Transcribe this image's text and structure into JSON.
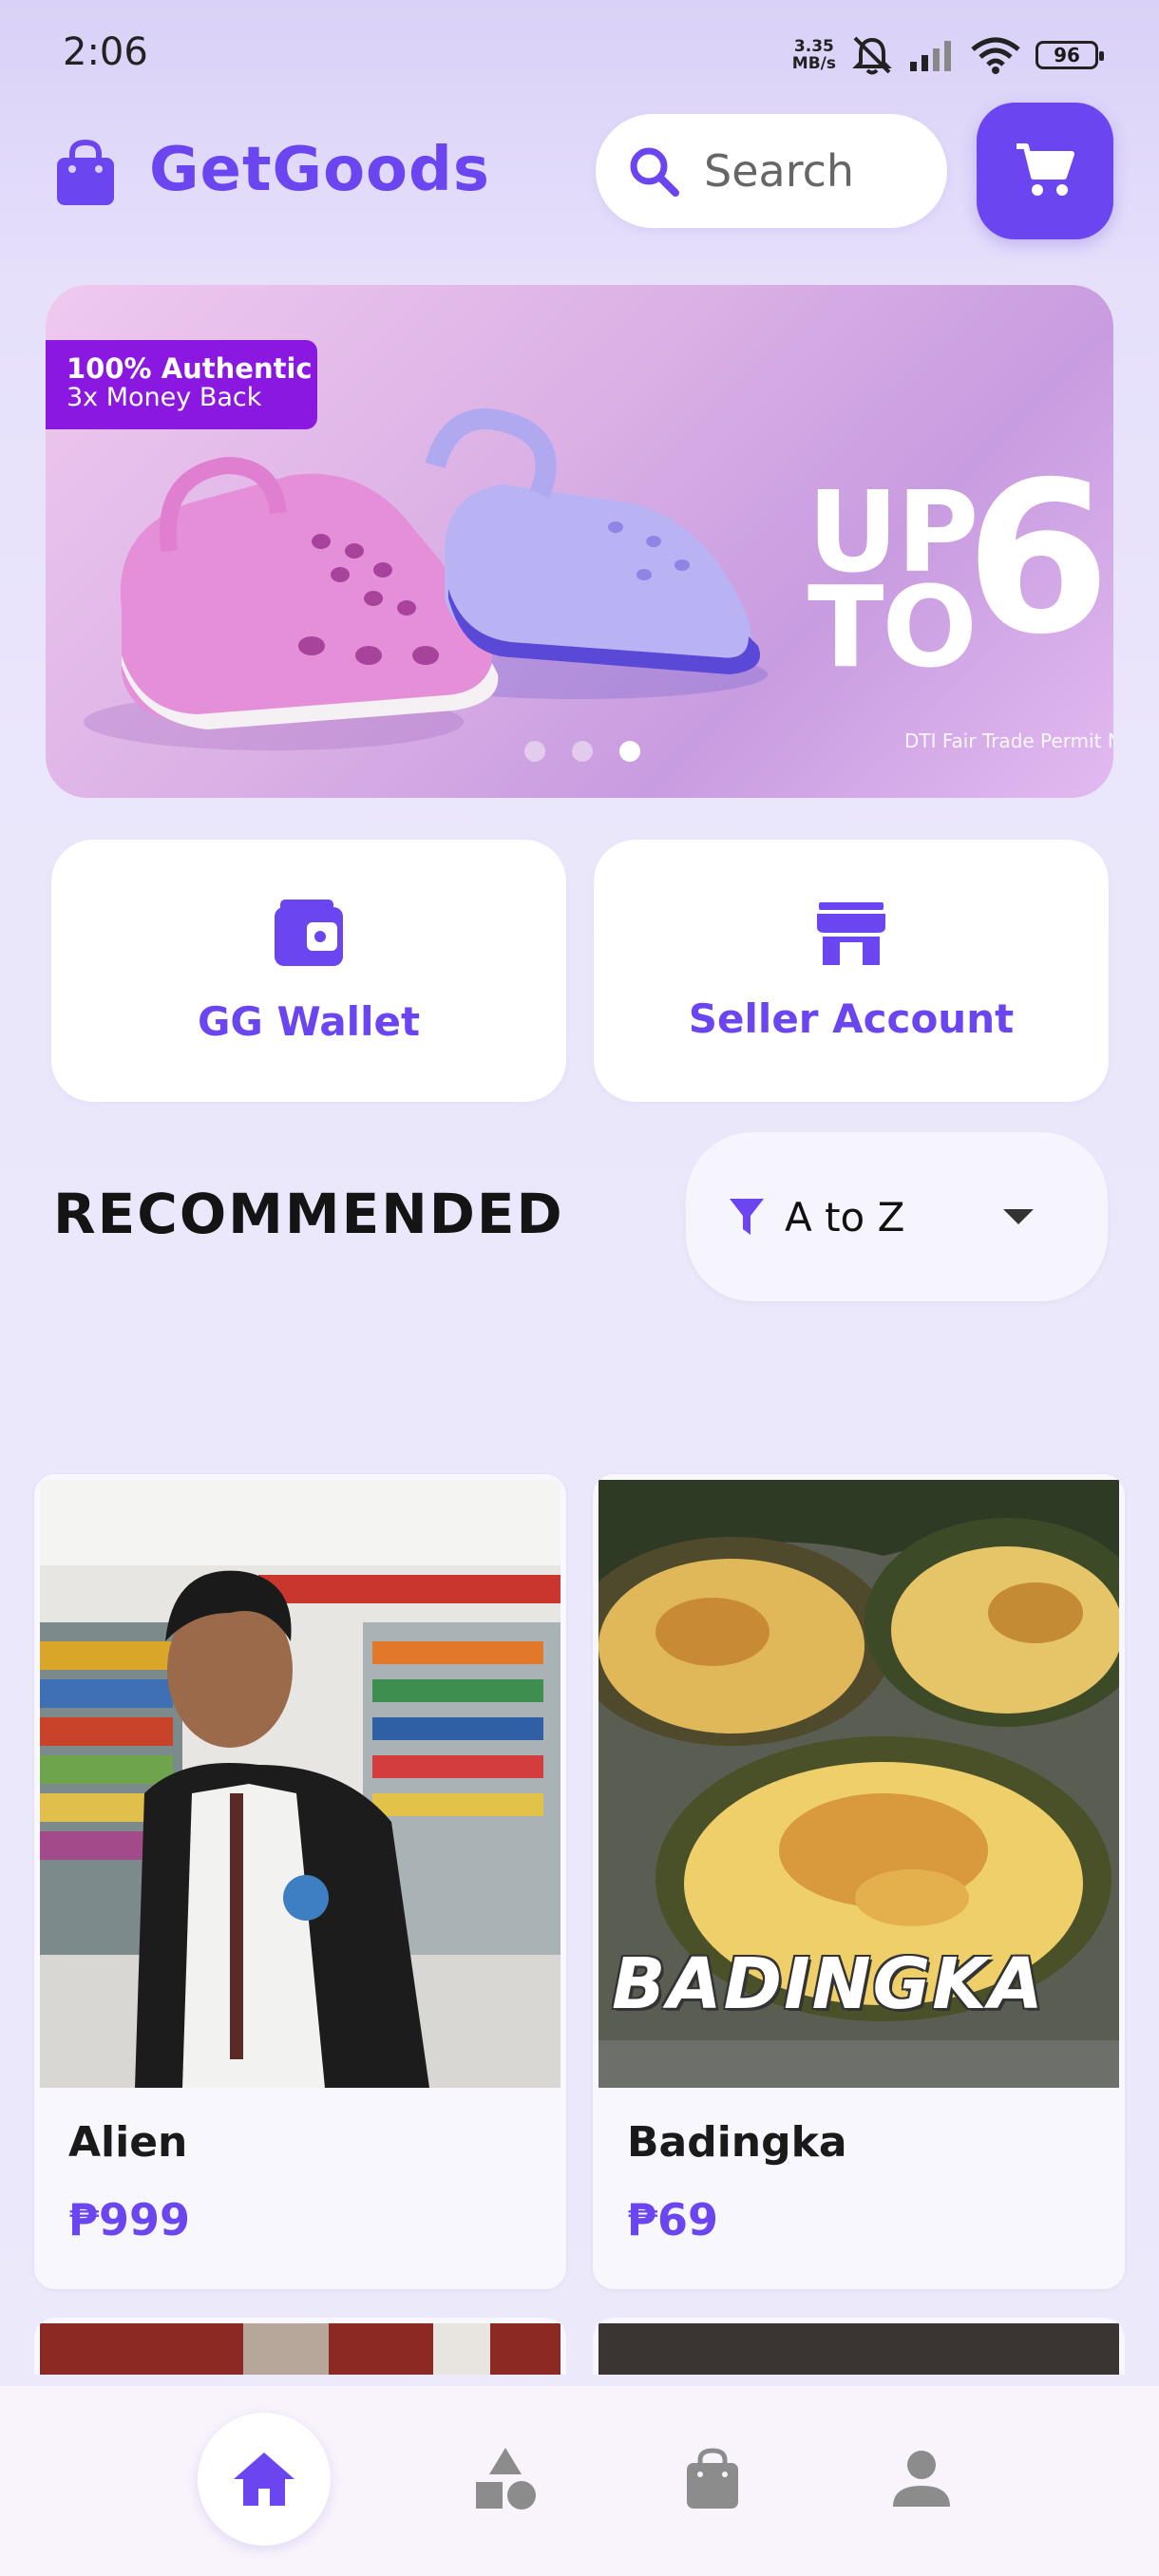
{
  "status_bar": {
    "time": "2:06",
    "net_speed_value": "3.35",
    "net_speed_unit": "MB/s",
    "battery": "96"
  },
  "header": {
    "app_name": "GetGoods",
    "search_placeholder": "Search"
  },
  "banner": {
    "badge_line1": "100% Authentic",
    "badge_line2": "3x Money Back",
    "promo_word_1": "UP",
    "promo_word_2": "TO",
    "promo_number": "6",
    "permit_text": "DTI Fair Trade Permit No",
    "slide_count": 3,
    "active_slide": 3
  },
  "actions": {
    "wallet_label": "GG Wallet",
    "seller_label": "Seller Account"
  },
  "recommended": {
    "title": "RECOMMENDED",
    "sort_value": "A to Z"
  },
  "products": [
    {
      "name": "Alien",
      "price": "₱999"
    },
    {
      "name": "Badingka",
      "price": "₱69",
      "image_overlay_text": "BADINGKA"
    }
  ],
  "colors": {
    "accent": "#6a45f0",
    "badge": "#8a18e0",
    "background": "#ebe7fb"
  },
  "bottom_nav": {
    "items": [
      "home-icon",
      "categories-icon",
      "shopping-bag-icon",
      "profile-icon"
    ],
    "active": "home-icon"
  }
}
